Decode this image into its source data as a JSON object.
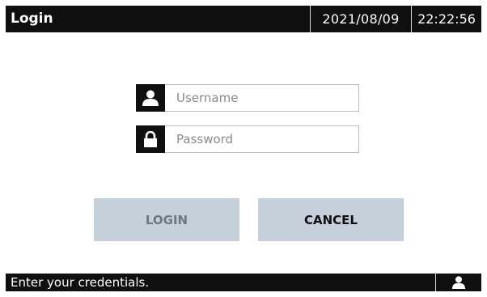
{
  "header": {
    "title": "Login",
    "date": "2021/08/09",
    "time": "22:22:56"
  },
  "form": {
    "username": {
      "placeholder": "Username",
      "value": "",
      "icon": "user-icon"
    },
    "password": {
      "placeholder": "Password",
      "value": "",
      "icon": "lock-icon"
    }
  },
  "buttons": {
    "login_label": "LOGIN",
    "cancel_label": "CANCEL"
  },
  "status": {
    "message": "Enter your credentials.",
    "user_icon": "user-icon"
  },
  "colors": {
    "bar": "#0f0f0f",
    "button": "#c5d0da",
    "button_disabled_text": "#6f7780"
  }
}
